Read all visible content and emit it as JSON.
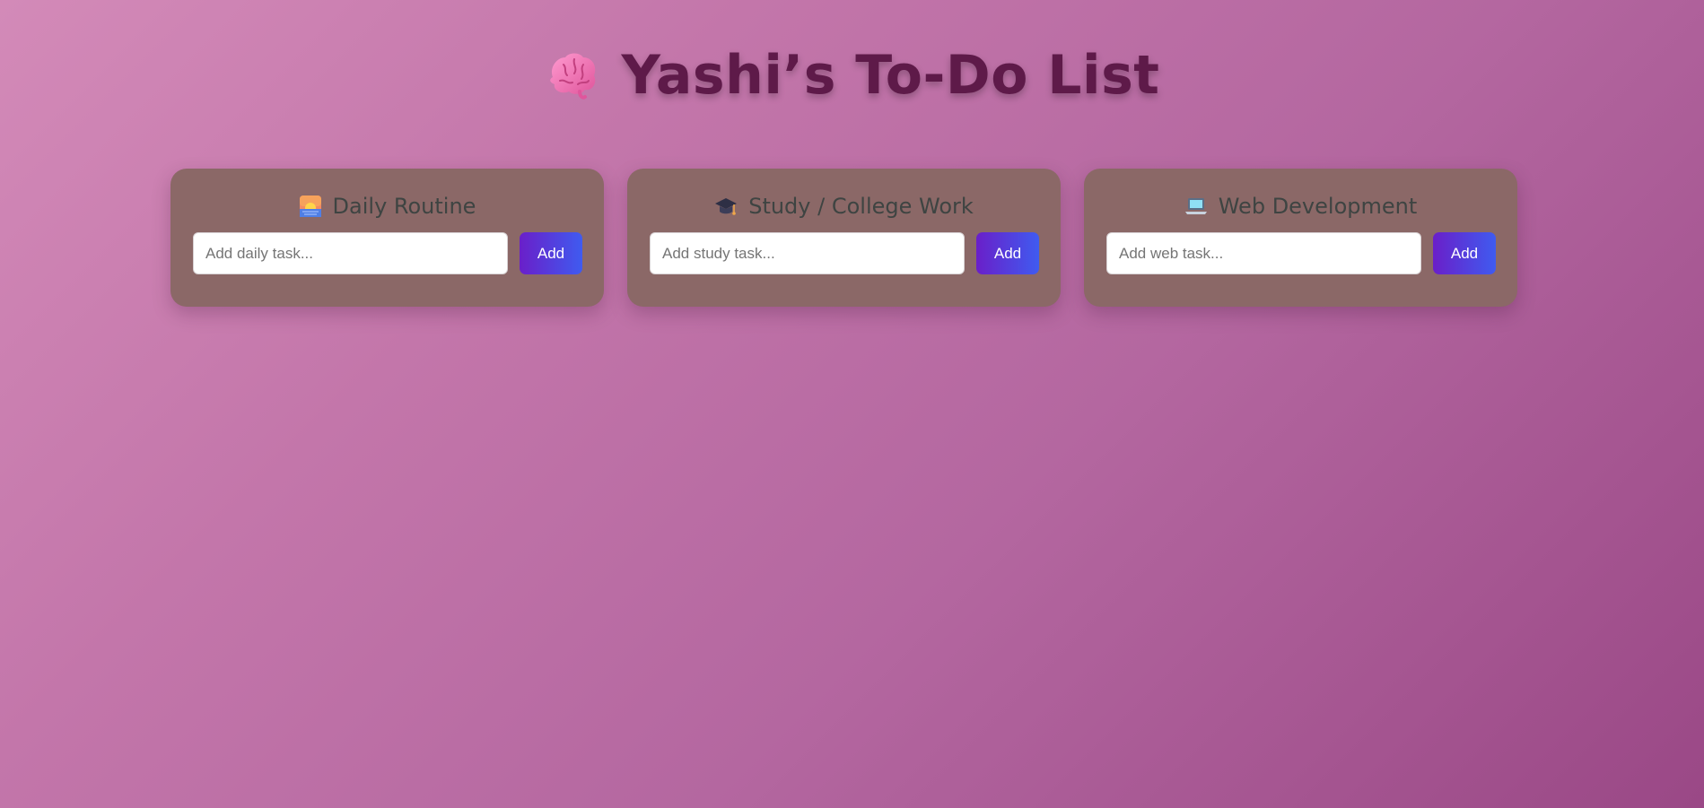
{
  "header": {
    "icon": "brain-icon",
    "title": "Yashi’s To-Do List"
  },
  "colors": {
    "title": "#5e1a49",
    "card_bg": "#8b6867",
    "card_title": "#3e4442",
    "button_start": "#6a1fc9",
    "button_end": "#3f5bf0"
  },
  "cards": [
    {
      "icon": "sunrise-icon",
      "title": "Daily Routine",
      "input_placeholder": "Add daily task...",
      "input_value": "",
      "button_label": "Add"
    },
    {
      "icon": "graduation-cap-icon",
      "title": "Study / College Work",
      "input_placeholder": "Add study task...",
      "input_value": "",
      "button_label": "Add"
    },
    {
      "icon": "laptop-icon",
      "title": "Web Development",
      "input_placeholder": "Add web task...",
      "input_value": "",
      "button_label": "Add"
    }
  ]
}
